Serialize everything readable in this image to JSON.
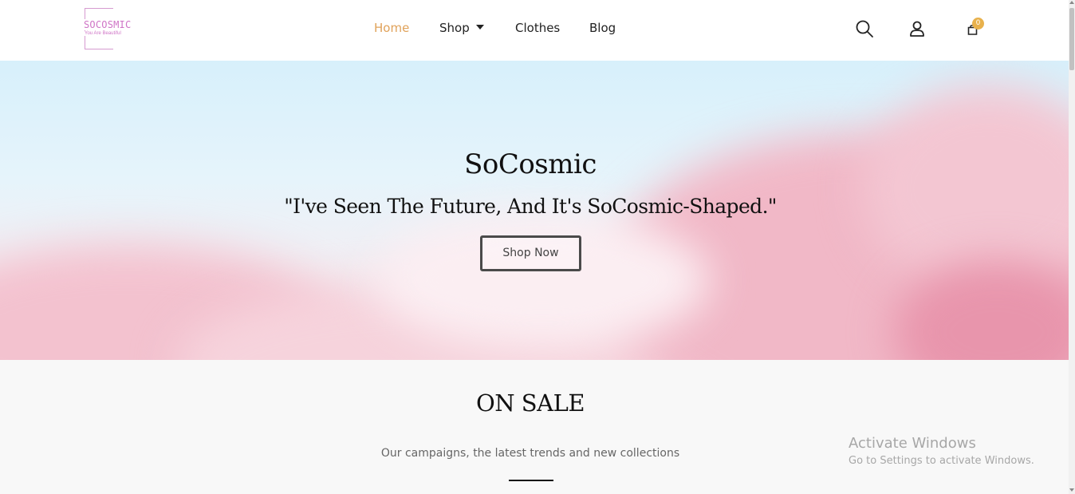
{
  "brand": {
    "name": "SOCOSMIC",
    "tagline": "You Are Beautiful"
  },
  "nav": {
    "items": [
      {
        "label": "Home",
        "active": true
      },
      {
        "label": "Shop",
        "has_dropdown": true
      },
      {
        "label": "Clothes"
      },
      {
        "label": "Blog"
      }
    ]
  },
  "header_icons": {
    "search": "search-icon",
    "account": "user-icon",
    "cart": "shopping-bag-icon",
    "cart_count": "0"
  },
  "hero": {
    "title": "SoCosmic",
    "subtitle": "\"I've Seen The Future, And It's SoCosmic-Shaped.\"",
    "button_label": "Shop Now"
  },
  "sale": {
    "title": "ON SALE",
    "subtitle": "Our campaigns, the latest trends and new collections"
  },
  "watermark": {
    "line1": "Activate Windows",
    "line2": "Go to Settings to activate Windows."
  },
  "colors": {
    "accent": "#e0a25a",
    "badge": "#e8b14c",
    "logo": "#cf74c6"
  }
}
